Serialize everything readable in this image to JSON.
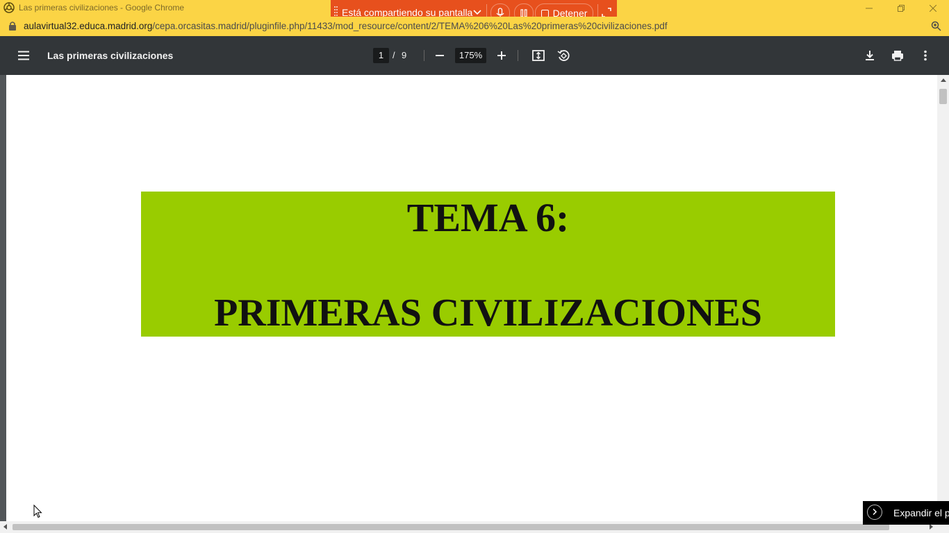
{
  "window": {
    "title": "Las primeras civilizaciones - Google Chrome"
  },
  "share_bar": {
    "status_text": "Está compartiendo su pantalla",
    "stop_label": "Detener"
  },
  "address": {
    "url_host": "aulavirtual32.educa.madrid.org",
    "url_path": "/cepa.orcasitas.madrid/pluginfile.php/11433/mod_resource/content/2/TEMA%206%20Las%20primeras%20civilizaciones.pdf"
  },
  "pdf_toolbar": {
    "doc_title": "Las primeras civilizaciones",
    "current_page": "1",
    "page_separator": "/",
    "total_pages": "9",
    "zoom": "175%"
  },
  "document": {
    "heading_line1": "TEMA 6:",
    "heading_line2": "PRIMERAS CIVILIZACIONES",
    "banner_color": "#99cc00"
  },
  "side_panel": {
    "expand_label": "Expandir el pa"
  },
  "colors": {
    "titlebar": "#fbd445",
    "sharebar": "#e7501d",
    "pdf_toolbar": "#323639"
  },
  "icons": [
    "app-icon",
    "minimize-icon",
    "maximize-icon",
    "close-icon",
    "drag-handle-icon",
    "chevron-down-icon",
    "microphone-icon",
    "pause-icon",
    "stop-icon",
    "expand-icon",
    "lock-icon",
    "zoom-icon",
    "menu-icon",
    "zoom-out-icon",
    "zoom-in-icon",
    "fit-page-icon",
    "rotate-icon",
    "download-icon",
    "print-icon",
    "more-options-icon",
    "arrow-right-circle-icon",
    "mouse-cursor-icon"
  ]
}
